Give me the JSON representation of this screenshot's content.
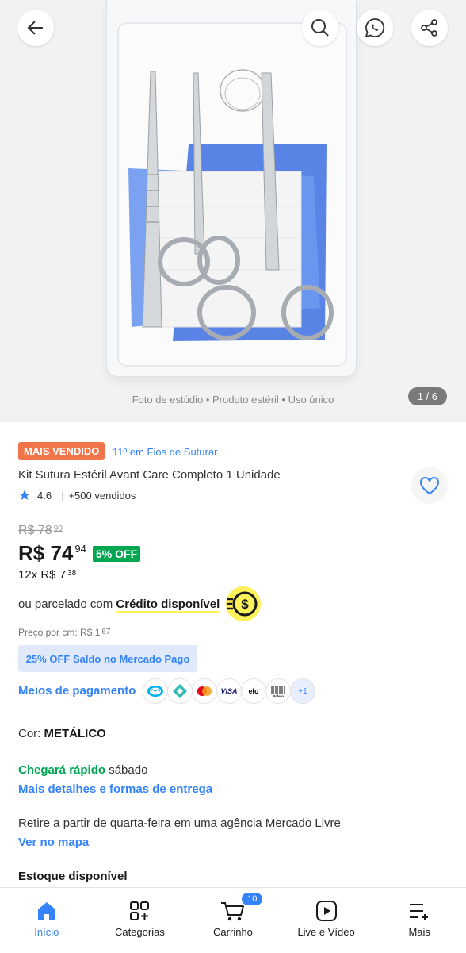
{
  "hero": {
    "caption": "Foto de estúdio • Produto estéril • Uso único",
    "counter": "1 / 6"
  },
  "header_icons": [
    "back-arrow-icon",
    "search-icon",
    "whatsapp-icon",
    "share-icon"
  ],
  "product": {
    "badge": "MAIS VENDIDO",
    "ranking": "11º em Fios de Suturar",
    "title": "Kit Sutura Estéril Avant Care Completo 1 Unidade",
    "rating": "4.6",
    "sold": "+500 vendidos",
    "old_price_int": "R$ 78",
    "old_price_cents": "90",
    "price_int": "R$ 74",
    "price_cents": "94",
    "discount": "5% OFF",
    "installments_int": "12x R$ 7",
    "installments_cents": "38",
    "credit_prefix": "ou parcelado com ",
    "credit_label": "Crédito disponível",
    "price_per_cm_int": "Preço por cm: R$ 1",
    "price_per_cm_cents": "67",
    "mp_offer": "25% OFF Saldo no Mercado Pago",
    "payment_heading": "Meios de pagamento",
    "payment_methods": [
      "Mercado Pago",
      "Pix",
      "Mastercard",
      "VISA",
      "elo",
      "Boleto"
    ],
    "payment_more": "+1",
    "color_label": "Cor: ",
    "color_value": "METÁLICO",
    "ship_fast": "Chegará rápido",
    "ship_day": " sábado",
    "ship_details": "Mais detalhes e formas de entrega",
    "pickup": "Retire a partir de quarta-feira em uma agência Mercado Livre",
    "map_link": "Ver no mapa",
    "stock": "Estoque disponível"
  },
  "colors": {
    "accent": "#3483fa",
    "green": "#00a650",
    "badge": "#f2744a",
    "yellow": "#fff159"
  },
  "tabbar": {
    "items": [
      {
        "label": "Início",
        "icon": "home-icon"
      },
      {
        "label": "Categorias",
        "icon": "categories-icon"
      },
      {
        "label": "Carrinho",
        "icon": "cart-icon"
      },
      {
        "label": "Live e Vídeo",
        "icon": "play-video-icon"
      },
      {
        "label": "Mais",
        "icon": "menu-plus-icon"
      }
    ],
    "cart_count": "10"
  }
}
